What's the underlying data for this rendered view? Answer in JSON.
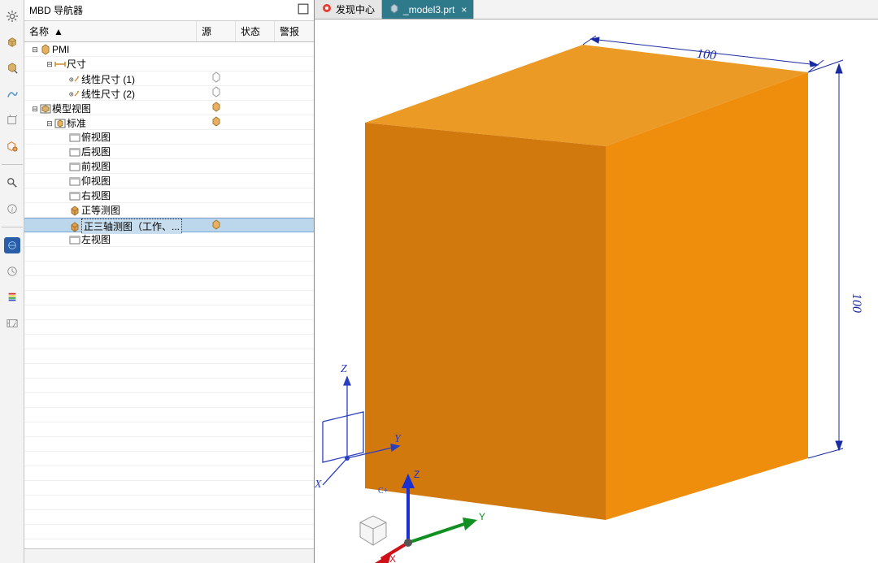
{
  "sidebar_toolbar_icons": [
    "gear-icon",
    "cube-icon",
    "annotate-icon",
    "spline-icon",
    "box-icon",
    "draft-icon",
    "search-icon",
    "info-icon",
    "globe-icon",
    "history-icon",
    "render-icon",
    "config-icon"
  ],
  "navigator": {
    "title": "MBD 导航器",
    "columns": {
      "name": "名称",
      "source": "源",
      "state": "状态",
      "alert": "警报"
    },
    "sort_indicator": "▲",
    "tree": [
      {
        "indent": 0,
        "twist": "-",
        "icon": "pmi-icon",
        "text": "PMI"
      },
      {
        "indent": 1,
        "twist": "-",
        "icon": "dim-icon",
        "text": "尺寸"
      },
      {
        "indent": 2,
        "twist": "",
        "icon": "linear-dim-icon",
        "text": "线性尺寸 (1)",
        "src_icon": "src-icon"
      },
      {
        "indent": 2,
        "twist": "",
        "icon": "linear-dim-icon",
        "text": "线性尺寸 (2)",
        "src_icon": "src-icon"
      },
      {
        "indent": 0,
        "twist": "-",
        "icon": "modelview-icon",
        "text": "模型视图",
        "src_icon": "view-src-icon"
      },
      {
        "indent": 1,
        "twist": "-",
        "icon": "standard-icon",
        "text": "标准",
        "src_icon": "view-src-icon"
      },
      {
        "indent": 2,
        "twist": "",
        "icon": "view-icon",
        "text": "俯视图"
      },
      {
        "indent": 2,
        "twist": "",
        "icon": "view-icon",
        "text": "后视图"
      },
      {
        "indent": 2,
        "twist": "",
        "icon": "view-icon",
        "text": "前视图"
      },
      {
        "indent": 2,
        "twist": "",
        "icon": "view-icon",
        "text": "仰视图"
      },
      {
        "indent": 2,
        "twist": "",
        "icon": "view-icon",
        "text": "右视图"
      },
      {
        "indent": 2,
        "twist": "",
        "icon": "iso-view-icon",
        "text": "正等测图"
      },
      {
        "indent": 2,
        "twist": "",
        "icon": "iso-view-icon",
        "text": "正三轴测图（工作、...",
        "selected": true,
        "src_icon": "view-src-icon"
      },
      {
        "indent": 2,
        "twist": "",
        "icon": "view-icon",
        "text": "左视图"
      }
    ]
  },
  "tabs": [
    {
      "icon": "discover-icon",
      "label": "发现中心",
      "active": false,
      "closable": false
    },
    {
      "icon": "model-tab-icon",
      "label": "_model3.prt",
      "active": true,
      "closable": true
    }
  ],
  "dimensions": {
    "top": "100",
    "right": "100"
  },
  "small_axes": {
    "x": "X",
    "y": "Y",
    "z": "Z"
  },
  "big_axes": {
    "x": "X",
    "y": "Y",
    "z": "Z",
    "cplus": "C+"
  }
}
